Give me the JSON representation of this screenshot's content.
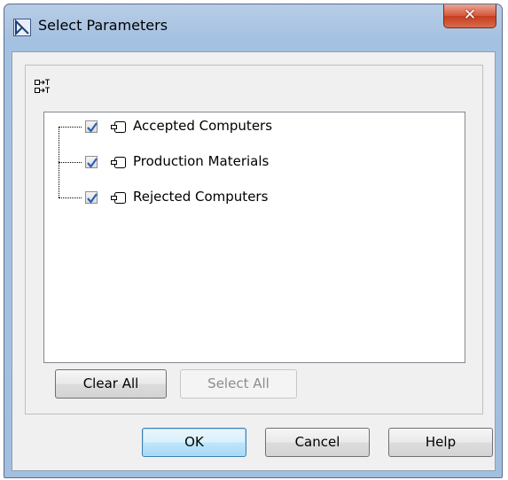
{
  "window": {
    "title": "Select Parameters",
    "close_symbol": "✕"
  },
  "toolbar": {
    "icon": "expand-all-icon"
  },
  "tree": {
    "items": [
      {
        "label": "Accepted Computers",
        "checked": true,
        "icon": "port-icon"
      },
      {
        "label": "Production Materials",
        "checked": true,
        "icon": "port-icon"
      },
      {
        "label": "Rejected Computers",
        "checked": true,
        "icon": "port-icon"
      }
    ]
  },
  "buttons": {
    "clear_all": "Clear All",
    "select_all": "Select All",
    "ok": "OK",
    "cancel": "Cancel",
    "help": "Help"
  },
  "colors": {
    "title_bar": "#a9c4e2",
    "close_button": "#c94a2c",
    "client_bg": "#f0f0f0",
    "checkmark": "#2b5fb4"
  }
}
